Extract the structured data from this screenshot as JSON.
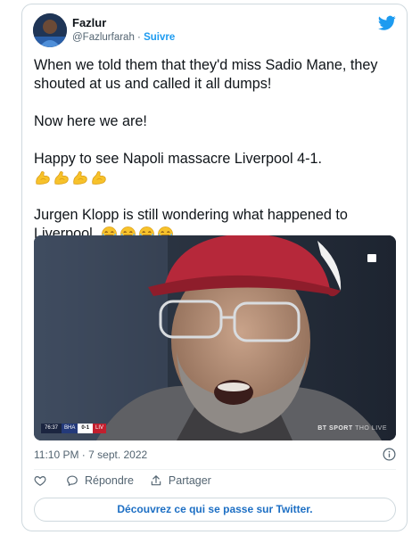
{
  "author": {
    "name": "Fazlur",
    "handle": "@Fazlurfarah",
    "separator": " · ",
    "follow_label": "Suivre"
  },
  "tweet": {
    "paragraph1": "When we told them that they'd miss Sadio Mane, they shouted at us and called it all dumps!",
    "paragraph2": "Now here we are!",
    "paragraph3": "Happy to see Napoli massacre Liverpool 4-1.",
    "paragraph4": "Jurgen Klopp is still wondering what happened to Liverpool.",
    "flex_emoji_count": 4,
    "laugh_emoji_count": 4
  },
  "media": {
    "scorebug": {
      "time": "76:37",
      "home": "BHA",
      "score": "0-1",
      "away": "LIV"
    },
    "watermark": "BT SPORT",
    "watermark_sub": "THO LIVE"
  },
  "timestamp": "11:10 PM · 7 sept. 2022",
  "actions": {
    "reply_label": "Répondre",
    "share_label": "Partager"
  },
  "cta_label": "Découvrez ce qui se passe sur Twitter.",
  "colors": {
    "accent": "#1d9bf0",
    "link": "#1d6fc4",
    "muted": "#536471",
    "border": "#cfd9de"
  }
}
